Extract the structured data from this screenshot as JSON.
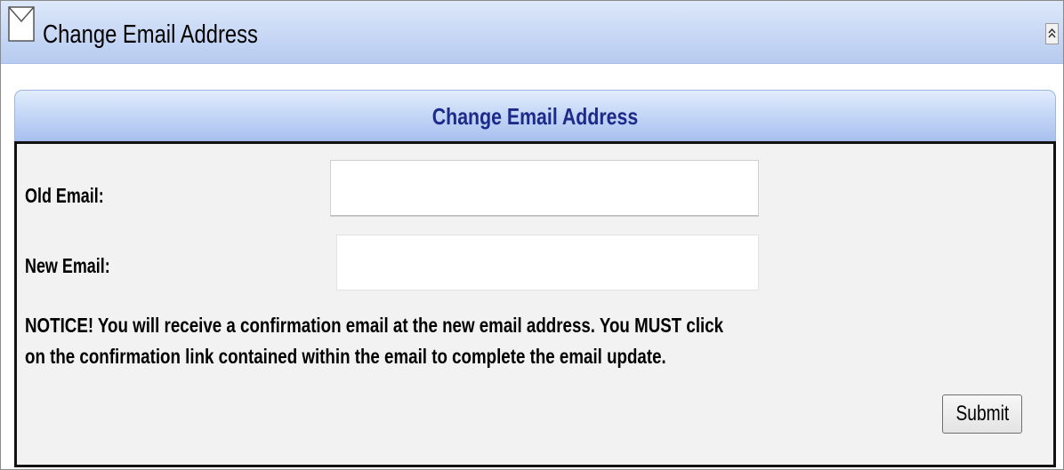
{
  "window": {
    "title": "Change Email Address",
    "icon": "envelope-icon",
    "collapse_icon": "double-chevron-up-icon"
  },
  "panel": {
    "title": "Change Email Address"
  },
  "form": {
    "old_email_label": "Old Email:",
    "old_email_value": "",
    "new_email_label": "New Email:",
    "new_email_value": "",
    "notice_line1": "NOTICE! You will receive a confirmation email at the new email address. You MUST click",
    "notice_line2": "on the confirmation link contained within the email to complete the email update.",
    "submit_label": "Submit"
  },
  "colors": {
    "panel_title": "#1c2a8a",
    "header_gradient_top": "#e2ecfc",
    "header_gradient_bottom": "#a9c1ef",
    "body_background": "#f2f2f2"
  }
}
